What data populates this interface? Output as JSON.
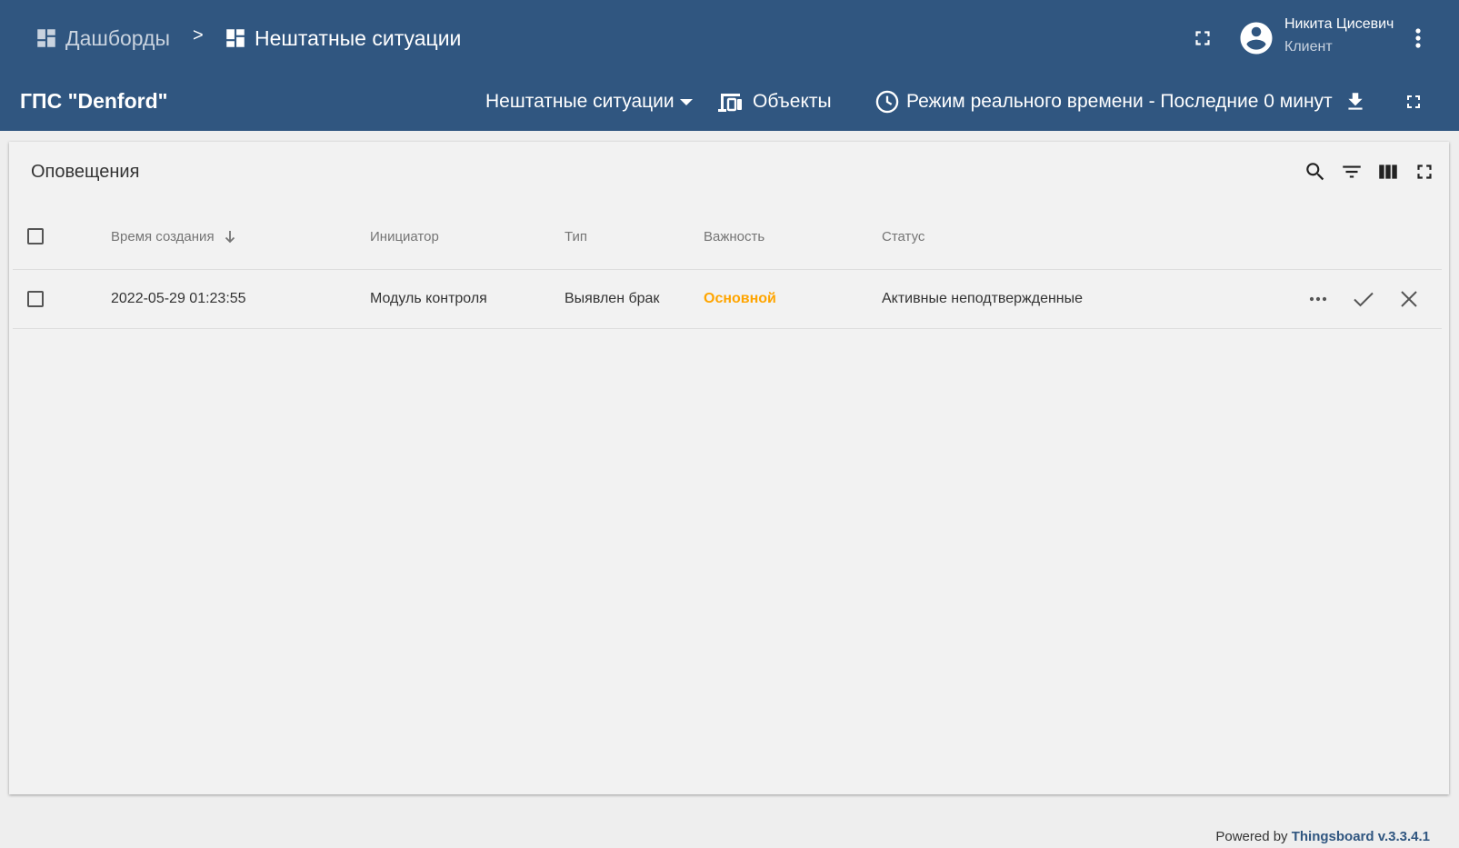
{
  "breadcrumb": {
    "parent": "Дашборды",
    "separator": ">",
    "current": "Нештатные ситуации"
  },
  "user": {
    "name": "Никита Цисевич",
    "role": "Клиент"
  },
  "dashboard": {
    "title": "ГПС \"Denford\"",
    "state": "Нештатные ситуации",
    "entities_label": "Объекты",
    "timewindow": "Режим реального времени - Последние 0 минут"
  },
  "widget": {
    "title": "Оповещения",
    "columns": [
      "Время создания",
      "Инициатор",
      "Тип",
      "Важность",
      "Статус"
    ],
    "rows": [
      {
        "created": "2022-05-29 01:23:55",
        "originator": "Модуль контроля",
        "type": "Выявлен брак",
        "severity": "Основной",
        "status": "Активные неподтвержденные"
      }
    ]
  },
  "footer": {
    "prefix": "Powered by",
    "brand": "Thingsboard v.3.3.4.1"
  },
  "colors": {
    "header_bg": "#305680",
    "severity_major": "#ffa500"
  }
}
